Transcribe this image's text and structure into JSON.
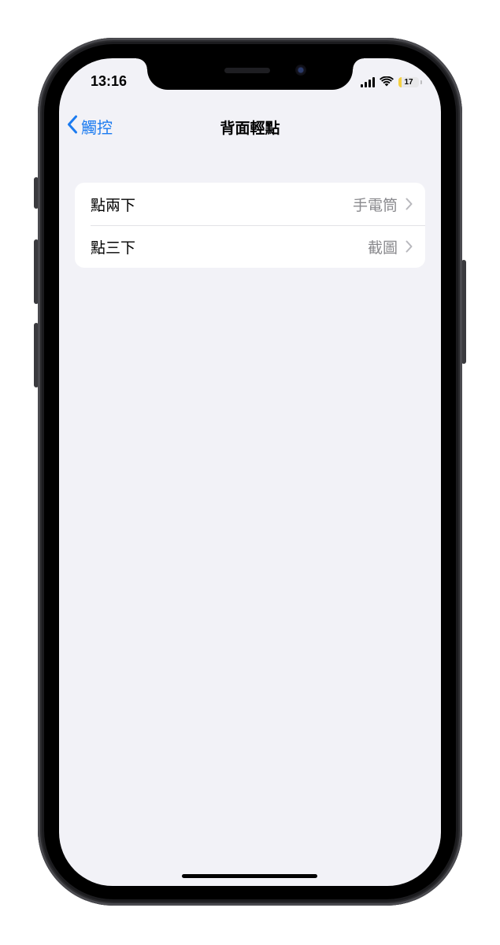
{
  "status_bar": {
    "time": "13:16",
    "battery_level": "17",
    "battery_color": "#f5d142"
  },
  "nav": {
    "back_label": "觸控",
    "title": "背面輕點",
    "accent_color": "#1b7bf0"
  },
  "list": {
    "items": [
      {
        "label": "點兩下",
        "value": "手電筒"
      },
      {
        "label": "點三下",
        "value": "截圖"
      }
    ]
  },
  "icons": {
    "back": "chevron-left-icon",
    "disclosure": "chevron-right-icon",
    "signal": "cellular-signal-icon",
    "wifi": "wifi-icon",
    "battery": "battery-icon"
  }
}
